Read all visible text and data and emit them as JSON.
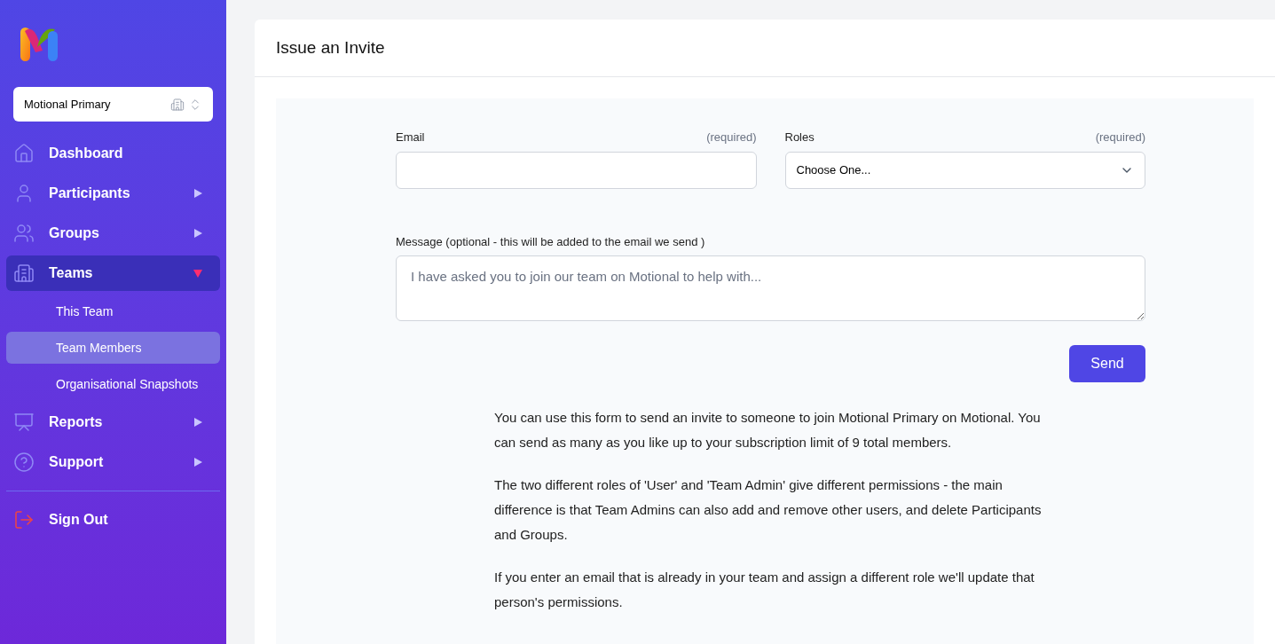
{
  "sidebar": {
    "team_selector": "Motional Primary",
    "nav": [
      {
        "label": "Dashboard",
        "kind": "link",
        "selected": false
      },
      {
        "label": "Participants",
        "kind": "menu",
        "expanded": false,
        "selected": false
      },
      {
        "label": "Groups",
        "kind": "menu",
        "expanded": false,
        "selected": false
      },
      {
        "label": "Teams",
        "kind": "menu",
        "expanded": true,
        "selected": true,
        "children": [
          {
            "label": "This Team",
            "selected": false
          },
          {
            "label": "Team Members",
            "selected": true
          },
          {
            "label": "Organisational Snapshots",
            "selected": false
          }
        ]
      },
      {
        "label": "Reports",
        "kind": "menu",
        "expanded": false,
        "selected": false
      },
      {
        "label": "Support",
        "kind": "menu",
        "expanded": false,
        "selected": false
      }
    ],
    "sign_out": "Sign Out"
  },
  "page": {
    "title": "Issue an Invite",
    "email": {
      "label": "Email",
      "note": "(required)"
    },
    "roles": {
      "label": "Roles",
      "note": "(required)",
      "value": "Choose One..."
    },
    "message": {
      "label": "Message (optional - this will be added to the email we send )",
      "placeholder": "I have asked you to join our team on Motional to help with..."
    },
    "send": "Send",
    "paragraphs": [
      "You can use this form to send an invite to someone to join Motional Primary on Motional. You can send as many as you like up to your subscription limit of 9 total members.",
      "The two different roles of 'User' and 'Team Admin' give different permissions - the main difference is that Team Admins can also add and remove other users, and delete Participants and Groups.",
      "If you enter an email that is already in your team and assign a different role we'll update that person's permissions."
    ]
  }
}
